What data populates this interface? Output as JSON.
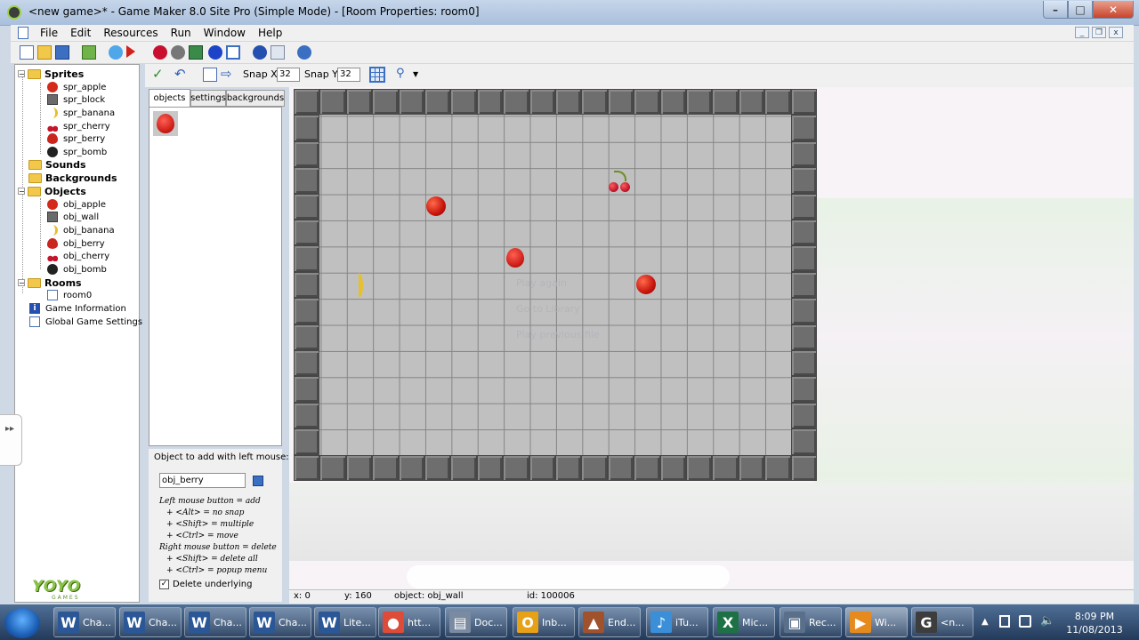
{
  "window": {
    "title": "<new game>* - Game Maker 8.0 Site Pro (Simple Mode) - [Room Properties: room0]",
    "minimize": "–",
    "maximize": "□",
    "close": "✕"
  },
  "menu": [
    "File",
    "Edit",
    "Resources",
    "Run",
    "Window",
    "Help"
  ],
  "tree": {
    "sprites": {
      "label": "Sprites",
      "items": [
        "spr_apple",
        "spr_block",
        "spr_banana",
        "spr_cherry",
        "spr_berry",
        "spr_bomb"
      ]
    },
    "sounds": "Sounds",
    "backgrounds": "Backgrounds",
    "objects": {
      "label": "Objects",
      "items": [
        "obj_apple",
        "obj_wall",
        "obj_banana",
        "obj_berry",
        "obj_cherry",
        "obj_bomb"
      ]
    },
    "rooms": {
      "label": "Rooms",
      "items": [
        "room0"
      ]
    },
    "game_information": "Game Information",
    "global_settings": "Global Game Settings"
  },
  "room_toolbar": {
    "snap_x_label": "Snap X",
    "snap_x": "32",
    "snap_y_label": "Snap Y",
    "snap_y": "32"
  },
  "tabs": [
    "objects",
    "settings",
    "backgrounds"
  ],
  "object_panel": {
    "label": "Object to add with left mouse:",
    "selected": "obj_berry",
    "help": [
      "Left mouse button = add",
      "+ <Alt> = no snap",
      "+ <Shift> = multiple",
      "+ <Ctrl> = move",
      "Right mouse button = delete",
      "+ <Shift> = delete all",
      "+ <Ctrl> = popup menu"
    ],
    "delete_underlying": "Delete underlying",
    "check_mark": "✓"
  },
  "overlay": [
    "Play again",
    "Go to Library",
    "Play previous file"
  ],
  "status": {
    "x": "x: 0",
    "y": "y: 160",
    "object": "object: obj_wall",
    "id": "id: 100006"
  },
  "logo": {
    "brand": "YOYO",
    "sub": "GAMES"
  },
  "taskbar": {
    "items": [
      {
        "label": "Cha...",
        "icon": "W",
        "color": "#2b5797"
      },
      {
        "label": "Cha...",
        "icon": "W",
        "color": "#2b5797"
      },
      {
        "label": "Cha...",
        "icon": "W",
        "color": "#2b5797"
      },
      {
        "label": "Cha...",
        "icon": "W",
        "color": "#2b5797"
      },
      {
        "label": "Lite...",
        "icon": "W",
        "color": "#2b5797"
      },
      {
        "label": "htt...",
        "icon": "●",
        "color": "#dd4b39"
      },
      {
        "label": "Doc...",
        "icon": "▤",
        "color": "#7a8aa0"
      },
      {
        "label": "Inb...",
        "icon": "O",
        "color": "#e6a117"
      },
      {
        "label": "End...",
        "icon": "▲",
        "color": "#a0522d"
      },
      {
        "label": "iTu...",
        "icon": "♪",
        "color": "#3a8fd8"
      },
      {
        "label": "Mic...",
        "icon": "X",
        "color": "#1e7145"
      },
      {
        "label": "Rec...",
        "icon": "▣",
        "color": "#5a6f8a"
      },
      {
        "label": "Wi...",
        "icon": "▶",
        "color": "#e68a1e"
      },
      {
        "label": "<n...",
        "icon": "G",
        "color": "#3d3d3d"
      }
    ],
    "time": "8:09 PM",
    "date": "11/08/2013"
  },
  "colors": {
    "accent": "#2b5797",
    "grid": "#c0c0c0",
    "wall": "#6e6e6e"
  }
}
